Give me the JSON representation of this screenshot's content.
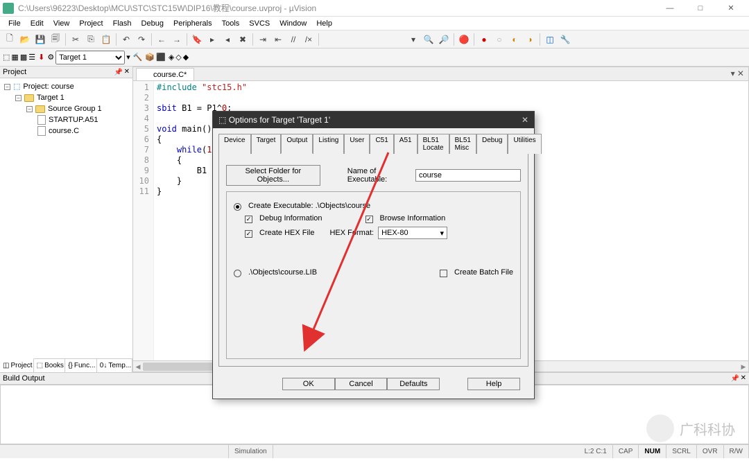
{
  "window": {
    "title": "C:\\Users\\96223\\Desktop\\MCU\\STC\\STC15W\\DIP16\\教程\\course.uvproj - µVision",
    "minimize": "—",
    "maximize": "□",
    "close": "✕"
  },
  "menu": [
    "File",
    "Edit",
    "View",
    "Project",
    "Flash",
    "Debug",
    "Peripherals",
    "Tools",
    "SVCS",
    "Window",
    "Help"
  ],
  "toolbar2": {
    "target": "Target 1"
  },
  "project": {
    "panel_title": "Project",
    "root": "Project: course",
    "target": "Target 1",
    "group": "Source Group 1",
    "file1": "STARTUP.A51",
    "file2": "course.C",
    "tabs": [
      "Project",
      "Books",
      "Func...",
      "Temp..."
    ]
  },
  "editor": {
    "tab": "course.C*",
    "gutter": [
      "1",
      "2",
      "3",
      "4",
      "5",
      "6",
      "7",
      "8",
      "9",
      "10",
      "11"
    ],
    "code": "#include \"stc15.h\"\n\nsbit B1 = P1^0;\n\nvoid main()\n{\n    while(1)\n    {\n        B1 = 0;\n    }\n}"
  },
  "buildout": {
    "title": "Build Output"
  },
  "statusbar": {
    "sim": "Simulation",
    "pos": "L:2 C:1",
    "caps": "CAP",
    "num": "NUM",
    "scrl": "SCRL",
    "ovr": "OVR",
    "rw": "R/W"
  },
  "dialog": {
    "title": "Options for Target 'Target 1'",
    "tabs": [
      "Device",
      "Target",
      "Output",
      "Listing",
      "User",
      "C51",
      "A51",
      "BL51 Locate",
      "BL51 Misc",
      "Debug",
      "Utilities"
    ],
    "active_tab": "Output",
    "select_folder": "Select Folder for Objects...",
    "name_label": "Name of Executable:",
    "name_value": "course",
    "create_exec": "Create Executable:  .\\Objects\\course",
    "debug_info": "Debug Information",
    "browse_info": "Browse Information",
    "create_hex": "Create HEX File",
    "hex_format_label": "HEX Format:",
    "hex_format_value": "HEX-80",
    "create_lib": ".\\Objects\\course.LIB",
    "create_batch": "Create Batch File",
    "buttons": {
      "ok": "OK",
      "cancel": "Cancel",
      "defaults": "Defaults",
      "help": "Help"
    }
  },
  "watermark": "广科科协"
}
